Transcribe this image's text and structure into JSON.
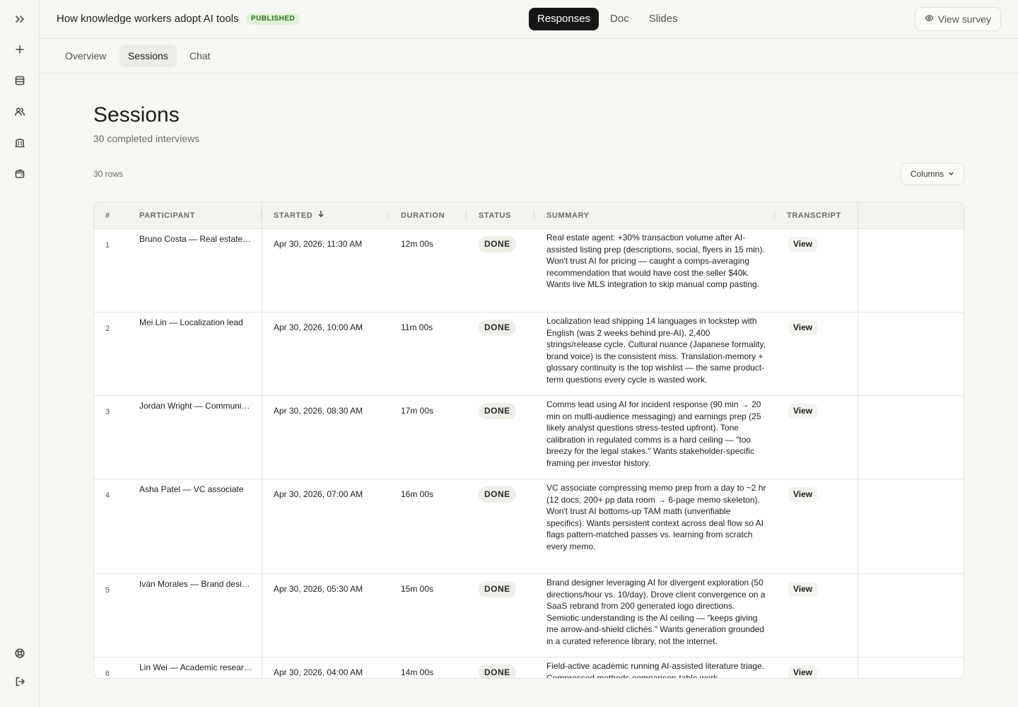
{
  "app": {
    "title": "How knowledge workers adopt AI tools",
    "status_badge": "PUBLISHED",
    "view_tabs": [
      "Responses",
      "Doc",
      "Slides"
    ],
    "active_view": "Responses",
    "view_survey_label": "View survey"
  },
  "rail_icons": [
    "expand-sidebar-icon",
    "plus-icon",
    "table-icon",
    "users-icon",
    "building-icon",
    "wallet-icon",
    "help-icon",
    "logout-icon"
  ],
  "subtabs": [
    "Overview",
    "Sessions",
    "Chat"
  ],
  "active_subtab": "Sessions",
  "page": {
    "title": "Sessions",
    "subtitle": "30 completed interviews",
    "row_count": "30 rows",
    "columns_label": "Columns"
  },
  "table": {
    "headers": [
      "#",
      "PARTICIPANT",
      "STARTED",
      "DURATION",
      "STATUS",
      "SUMMARY",
      "TRANSCRIPT"
    ],
    "sort_column": "STARTED",
    "sort_direction": "descending",
    "rows": [
      {
        "num": "1",
        "participant": "Bruno Costa — Real estate agent",
        "started": "Apr 30, 2026, 11:30 AM",
        "duration": "12m 00s",
        "status": "DONE",
        "summary": "Real estate agent: +30% transaction volume after AI-assisted listing prep (descriptions, social, flyers in 15 min). Won't trust AI for pricing — caught a comps-averaging recommendation that would have cost the seller $40k. Wants live MLS integration to skip manual comp pasting.",
        "transcript": "View"
      },
      {
        "num": "2",
        "participant": "Mei Lin — Localization lead",
        "started": "Apr 30, 2026, 10:00 AM",
        "duration": "11m 00s",
        "status": "DONE",
        "summary": "Localization lead shipping 14 languages in lockstep with English (was 2 weeks behind pre-AI). 2,400 strings/release cycle. Cultural nuance (Japanese formality, brand voice) is the consistent miss. Translation-memory + glossary continuity is the top wishlist — the same product-term questions every cycle is wasted work.",
        "transcript": "View"
      },
      {
        "num": "3",
        "participant": "Jordan Wright — Communications lead",
        "started": "Apr 30, 2026, 08:30 AM",
        "duration": "17m 00s",
        "status": "DONE",
        "summary": "Comms lead using AI for incident response (90 min → 20 min on multi-audience messaging) and earnings prep (25 likely analyst questions stress-tested upfront). Tone calibration in regulated comms is a hard ceiling — \"too breezy for the legal stakes.\" Wants stakeholder-specific framing per investor history.",
        "transcript": "View"
      },
      {
        "num": "4",
        "participant": "Asha Patel — VC associate",
        "started": "Apr 30, 2026, 07:00 AM",
        "duration": "16m 00s",
        "status": "DONE",
        "summary": "VC associate compressing memo prep from a day to ~2 hr (12 docs, 200+ pp data room → 6-page memo skeleton). Won't trust AI bottoms-up TAM math (unverifiable specifics). Wants persistent context across deal flow so AI flags pattern-matched passes vs. learning from scratch every memo.",
        "transcript": "View"
      },
      {
        "num": "5",
        "participant": "Iván Morales — Brand designer",
        "started": "Apr 30, 2026, 05:30 AM",
        "duration": "15m 00s",
        "status": "DONE",
        "summary": "Brand designer leveraging AI for divergent exploration (50 directions/hour vs. 10/day). Drove client convergence on a SaaS rebrand from 200 generated logo directions. Semiotic understanding is the AI ceiling — \"keeps giving me arrow-and-shield clichés.\" Wants generation grounded in a curated reference library, not the internet.",
        "transcript": "View"
      },
      {
        "num": "6",
        "participant": "Lin Wei — Academic researcher",
        "started": "Apr 30, 2026, 04:00 AM",
        "duration": "14m 00s",
        "status": "DONE",
        "summary": "Field-active academic running AI-assisted literature triage. Compressed methods-comparison-table work",
        "transcript": "View"
      }
    ]
  }
}
